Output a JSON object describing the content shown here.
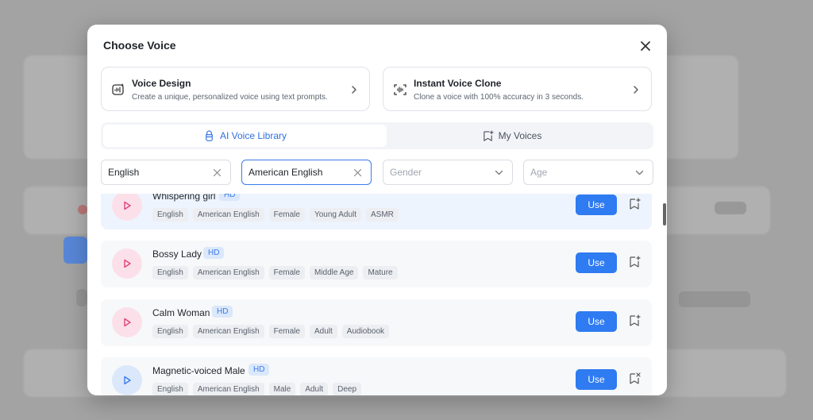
{
  "modal": {
    "title": "Choose Voice",
    "close_icon": "close-icon"
  },
  "cards": [
    {
      "title": "Voice Design",
      "desc": "Create a unique, personalized voice using text prompts.",
      "icon": "voice-design-icon"
    },
    {
      "title": "Instant Voice Clone",
      "desc": "Clone a voice with 100% accuracy in 3 seconds.",
      "icon": "voice-clone-icon"
    }
  ],
  "tabs": [
    {
      "label": "AI Voice Library",
      "icon": "library-icon",
      "active": true
    },
    {
      "label": "My Voices",
      "icon": "bookmark-star-icon",
      "active": false
    }
  ],
  "filters": [
    {
      "value": "English",
      "placeholder": "",
      "icon": "clear-icon"
    },
    {
      "value": "American English",
      "placeholder": "",
      "icon": "clear-icon"
    },
    {
      "value": "",
      "placeholder": "Gender",
      "icon": "chevron-down-icon"
    },
    {
      "value": "",
      "placeholder": "Age",
      "icon": "chevron-down-icon"
    }
  ],
  "voices": [
    {
      "name": "Whispering girl",
      "hd": "HD",
      "tags": [
        "English",
        "American English",
        "Female",
        "Young Adult",
        "ASMR"
      ],
      "color": "pink",
      "use": "Use",
      "bookmark": "bookmark-add-icon"
    },
    {
      "name": "Bossy Lady",
      "hd": "HD",
      "tags": [
        "English",
        "American English",
        "Female",
        "Middle Age",
        "Mature"
      ],
      "color": "pink",
      "use": "Use",
      "bookmark": "bookmark-add-icon"
    },
    {
      "name": "Calm Woman",
      "hd": "HD",
      "tags": [
        "English",
        "American English",
        "Female",
        "Adult",
        "Audiobook"
      ],
      "color": "pink",
      "use": "Use",
      "bookmark": "bookmark-add-icon"
    },
    {
      "name": "Magnetic-voiced Male",
      "hd": "HD",
      "tags": [
        "English",
        "American English",
        "Male",
        "Adult",
        "Deep"
      ],
      "color": "blue",
      "use": "Use",
      "bookmark": "bookmark-remove-icon"
    }
  ],
  "colors": {
    "accent": "#2f7bf1",
    "pink": "#e0457b",
    "blue": "#3b7bea"
  }
}
